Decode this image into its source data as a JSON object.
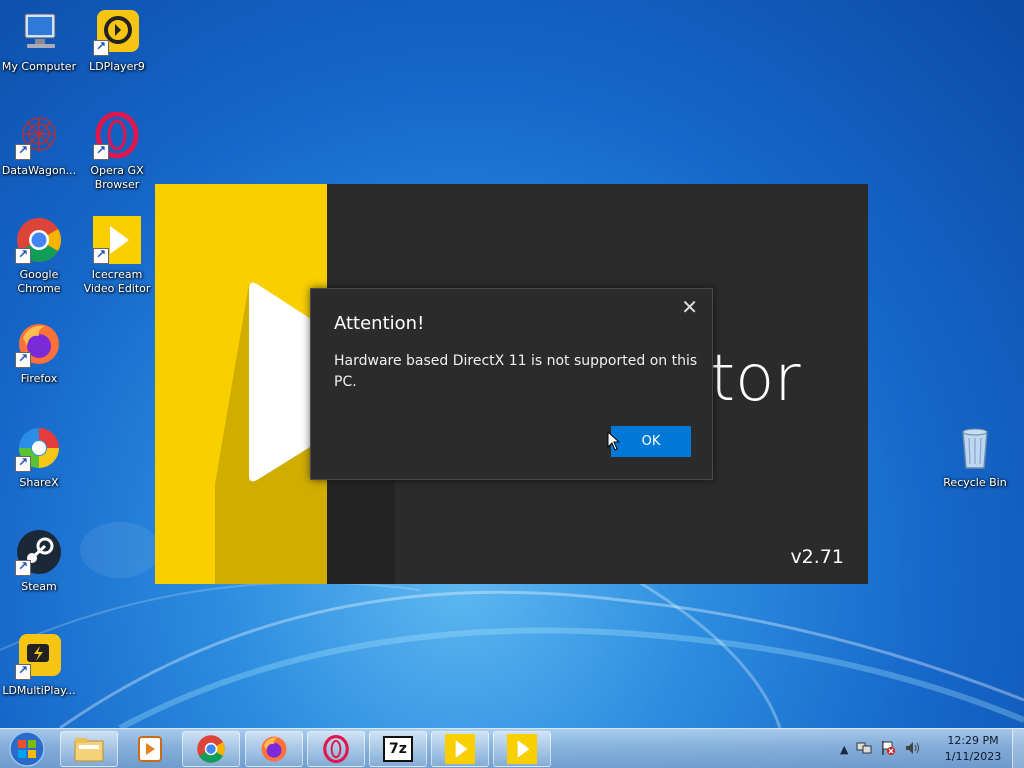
{
  "desktop": {
    "icons": [
      {
        "label": "My Computer",
        "icon": "computer-icon"
      },
      {
        "label": "LDPlayer9",
        "icon": "ldplayer-icon"
      },
      {
        "label": "DataWagon...",
        "icon": "datawagon-icon"
      },
      {
        "label": "Opera GX Browser",
        "icon": "opera-gx-icon"
      },
      {
        "label": "Google Chrome",
        "icon": "chrome-icon"
      },
      {
        "label": "Icecream Video Editor",
        "icon": "icecream-icon"
      },
      {
        "label": "Firefox",
        "icon": "firefox-icon"
      },
      {
        "label": "ShareX",
        "icon": "sharex-icon"
      },
      {
        "label": "Steam",
        "icon": "steam-icon"
      },
      {
        "label": "LDMultiPlay...",
        "icon": "ldmultiplayer-icon"
      },
      {
        "label": "Recycle Bin",
        "icon": "recycle-bin-icon"
      }
    ]
  },
  "splash": {
    "brand_fragment": "tor",
    "version": "v2.71",
    "accent_color": "#f9cf00"
  },
  "dialog": {
    "title": "Attention!",
    "message": "Hardware based DirectX 11 is not supported on this PC.",
    "ok_label": "OK",
    "close_glyph": "✕"
  },
  "taskbar": {
    "apps": [
      "windows-explorer-icon",
      "media-player-icon",
      "chrome-icon",
      "firefox-icon",
      "opera-icon",
      "7zip-icon",
      "icecream-icon",
      "icecream-icon"
    ],
    "sevenzip_label": "7z",
    "clock": {
      "time": "12:29 PM",
      "date": "1/11/2023"
    }
  }
}
